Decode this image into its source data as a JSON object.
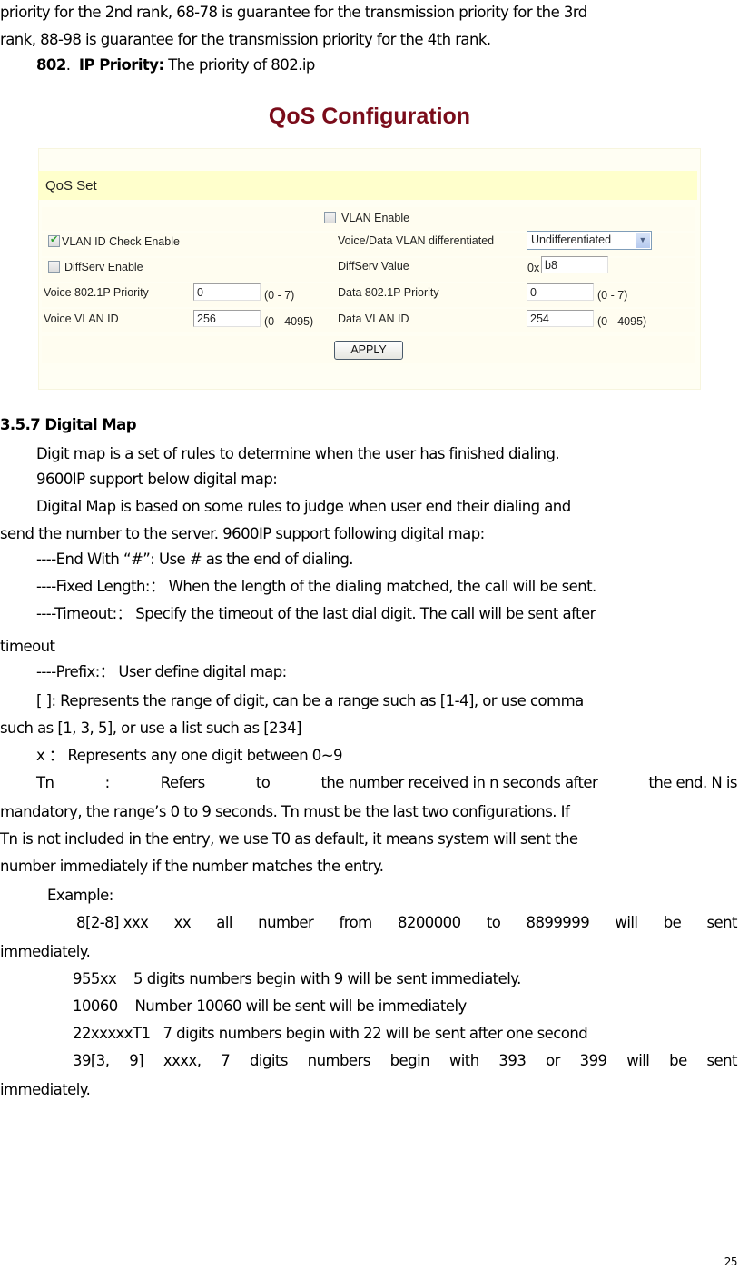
{
  "intro": {
    "line1": "priority for the 2nd rank, 68-78 is guarantee for the transmission priority for the 3rd",
    "line2": "rank, 88-98 is guarantee for the transmission priority for the 4th rank.",
    "ip_priority_num": "802",
    "ip_priority_label": "IP Priority:",
    "ip_priority_text": "The priority of 802.ip"
  },
  "qos": {
    "title": "QoS Configuration",
    "section": "QoS Set",
    "vlan_enable": {
      "label": "VLAN Enable",
      "checked": false
    },
    "vlan_id_check": {
      "label": "VLAN ID Check Enable",
      "checked": true
    },
    "diffserv_enable": {
      "label": "DiffServ Enable",
      "checked": false
    },
    "voice_data_diff": {
      "label": "Voice/Data VLAN differentiated",
      "value": "Undifferentiated"
    },
    "diffserv_value": {
      "label": "DiffServ Value",
      "prefix": "0x",
      "value": "b8"
    },
    "voice_priority": {
      "label": "Voice 802.1P Priority",
      "value": "0",
      "range": "(0 - 7)"
    },
    "data_priority": {
      "label": "Data 802.1P Priority",
      "value": "0",
      "range": "(0 - 7)"
    },
    "voice_vlan": {
      "label": "Voice VLAN ID",
      "value": "256",
      "range": "(0 - 4095)"
    },
    "data_vlan": {
      "label": "Data VLAN ID",
      "value": "254",
      "range": "(0 - 4095)"
    },
    "apply": "APPLY"
  },
  "section": {
    "heading": "3.5.7 Digital Map",
    "p1": "Digit map is a set of rules to determine when the user has finished dialing.",
    "p2": "9600IP support below digital map:",
    "p3a": "Digital Map is based on some rules to judge when user end their dialing and",
    "p3b": "send the number to the server. 9600IP support following digital map:",
    "rule_end": "----End With “#”:  Use # as the end of dialing.",
    "rule_fixed": "----Fixed Length:： When the length of the dialing matched, the call will be sent.",
    "rule_timeout_a": "----Timeout:： Specify the timeout of the last dial digit. The call will be sent after",
    "rule_timeout_b": "timeout",
    "rule_prefix": "----Prefix:： User define digital map:",
    "bracket_a": "[ ]:  Represents the range of digit, can be a range such as [1-4], or use comma",
    "bracket_b": "such as [1, 3, 5], or use a list such as [234]",
    "x_rule": "x ： Represents any one digit between 0~9",
    "tn_words": [
      "Tn",
      ":",
      "Refers",
      "to",
      "the number received in n seconds after",
      "the end. N is"
    ],
    "tn_b": "mandatory, the range’s 0 to 9 seconds. Tn must be the last two configurations.  If",
    "tn_c": "Tn is not included in the entry, we use T0 as default, it means system will sent the",
    "tn_d": "number immediately if the number matches the entry.",
    "example_label": "Example:",
    "ex1_words": [
      "8[2-8] xxx",
      "xx",
      "all",
      "number",
      "from",
      "8200000",
      "to",
      "8899999",
      "will",
      "be",
      "sent"
    ],
    "ex1_b": "immediately.",
    "ex2": "955xx    5 digits numbers begin with 9 will be sent immediately.",
    "ex3": "10060    Number 10060 will be sent will be immediately",
    "ex4": "22xxxxxT1   7 digits numbers begin with 22 will be sent after one second",
    "ex5_words": [
      "39[3,",
      "9]",
      "xxxx,",
      "7",
      "digits",
      "numbers",
      "begin",
      "with",
      "393",
      "or",
      "399",
      "will",
      "be",
      "sent"
    ],
    "ex5_b": "immediately."
  },
  "page_number": "25"
}
